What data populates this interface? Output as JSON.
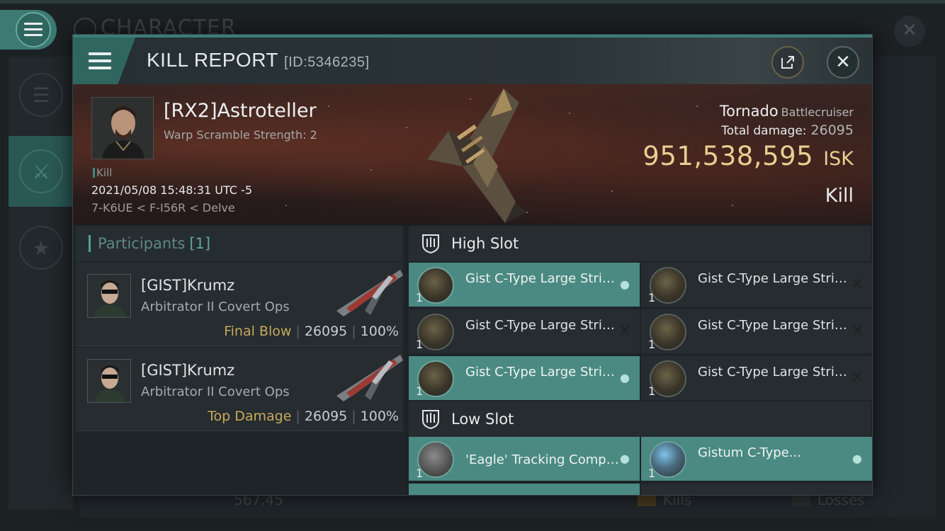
{
  "background": {
    "title": "CHARACTER",
    "bottom_value": "567.45",
    "bottom_kills_label": "Kills",
    "bottom_losses_label": "Losses"
  },
  "header": {
    "title": "KILL REPORT",
    "id": "[ID:5346235]"
  },
  "victim": {
    "name": "[RX2]Astroteller",
    "subtitle": "Warp Scramble Strength: 2",
    "tag": "Kill",
    "datetime": "2021/05/08 15:48:31 UTC -5",
    "location": "7-K6UE < F-I56R < Delve",
    "ship_name": "Tornado",
    "ship_class": "Battlecruiser",
    "total_damage_label": "Total damage:",
    "total_damage": "26095",
    "isk_value": "951,538,595",
    "isk_unit": "ISK",
    "result": "Kill"
  },
  "participants": {
    "label": "Participants",
    "count": "[1]",
    "rows": [
      {
        "name": "[GIST]Krumz",
        "ship": "Arbitrator II Covert Ops",
        "role": "Final Blow",
        "damage": "26095",
        "percent": "100%"
      },
      {
        "name": "[GIST]Krumz",
        "ship": "Arbitrator II Covert Ops",
        "role": "Top Damage",
        "damage": "26095",
        "percent": "100%"
      }
    ]
  },
  "fitting": {
    "high_slot_label": "High Slot",
    "low_slot_label": "Low Slot",
    "high": [
      {
        "name": "Gist C-Type Large Strike...",
        "qty": "1",
        "state": "dropped"
      },
      {
        "name": "Gist C-Type Large Strike...",
        "qty": "1",
        "state": "destroyed"
      },
      {
        "name": "Gist C-Type Large Strike...",
        "qty": "1",
        "state": "destroyed"
      },
      {
        "name": "Gist C-Type Large Strike...",
        "qty": "1",
        "state": "destroyed"
      },
      {
        "name": "Gist C-Type Large Strike...",
        "qty": "1",
        "state": "dropped"
      },
      {
        "name": "Gist C-Type Large Strike...",
        "qty": "1",
        "state": "destroyed"
      }
    ],
    "low": [
      {
        "name": "'Eagle' Tracking Computer",
        "qty": "1",
        "state": "dropped"
      },
      {
        "name": "Gistum C-Type...",
        "qty": "1",
        "state": "dropped"
      }
    ]
  }
}
